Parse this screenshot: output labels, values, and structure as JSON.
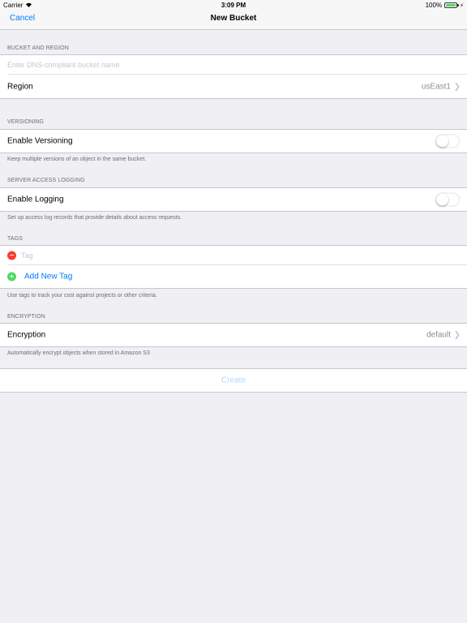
{
  "status_bar": {
    "carrier": "Carrier",
    "time": "3:09 PM",
    "battery_percent": "100%",
    "battery_level": 1.0
  },
  "nav": {
    "cancel_label": "Cancel",
    "title": "New Bucket"
  },
  "bucket_section": {
    "header": "BUCKET AND REGION",
    "name_placeholder": "Enter DNS-compliant bucket name",
    "region_label": "Region",
    "region_value": "usEast1"
  },
  "versioning_section": {
    "header": "VERSIONING",
    "toggle_label": "Enable Versioning",
    "toggle_on": false,
    "footer": "Keep multiple versions of an object in the same bucket."
  },
  "logging_section": {
    "header": "SERVER ACCESS LOGGING",
    "toggle_label": "Enable Logging",
    "toggle_on": false,
    "footer": "Set up access log records that provide details about access requests."
  },
  "tags_section": {
    "header": "TAGS",
    "tag_placeholder": "Tag",
    "add_tag_label": "Add New Tag",
    "footer": "Use tags to track your cost against projects or other criteria."
  },
  "encryption_section": {
    "header": "ENCRYPTION",
    "label": "Encryption",
    "value": "default",
    "footer": "Automatically encrypt objects when stored in Amazon S3"
  },
  "create_button": {
    "label": "Create"
  },
  "icons": {
    "wifi": "wifi-icon",
    "battery": "battery-icon",
    "chevron": "chevron-right-icon",
    "remove": "minus-circle-icon",
    "add": "plus-circle-icon"
  },
  "colors": {
    "accent": "#007aff",
    "background": "#efeff4",
    "remove": "#ff3b30",
    "add": "#4cd964",
    "disabled_action": "#b3d7ff"
  }
}
